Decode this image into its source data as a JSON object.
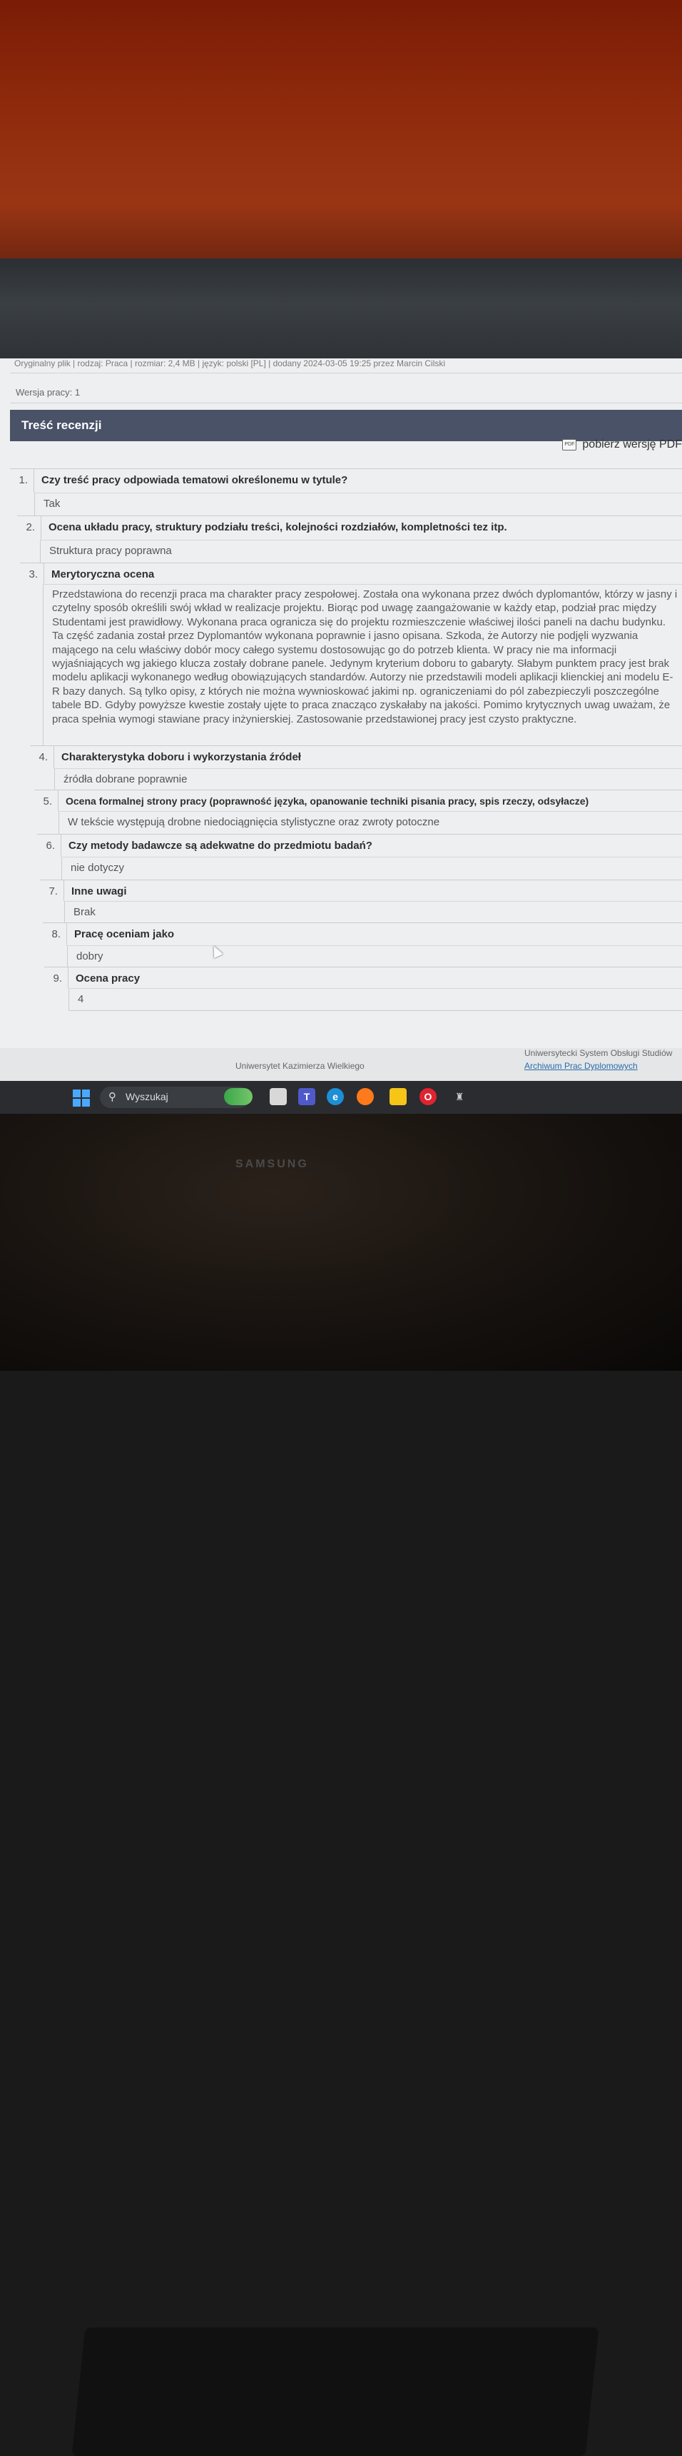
{
  "page": {
    "meta_line": "Oryginalny plik | rodzaj: Praca | rozmiar: 2,4 MB | język: polski [PL] | dodany 2024-03-05 19:25 przez Marcin Cilski",
    "version": "Wersja pracy: 1"
  },
  "review": {
    "header": "Treść recenzji",
    "pdf_label": "pobierz wersję PDF",
    "pdf_icon_text": "PDF",
    "items": [
      {
        "num": "1.",
        "question": "Czy treść pracy odpowiada tematowi określonemu w tytule?",
        "answer": "Tak"
      },
      {
        "num": "2.",
        "question": "Ocena układu pracy, struktury podziału treści, kolejności rozdziałów, kompletności tez itp.",
        "answer": "Struktura pracy poprawna"
      },
      {
        "num": "3.",
        "question": "Merytoryczna ocena",
        "answer": "Przedstawiona do recenzji praca ma charakter pracy zespołowej. Została ona wykonana przez dwóch dyplomantów, którzy w jasny i czytelny sposób określili swój wkład w realizacje projektu. Biorąc pod uwagę zaangażowanie w każdy etap, podział prac między Studentami jest prawidłowy. Wykonana praca ogranicza się do projektu rozmieszczenie właściwej ilości paneli na dachu budynku. Ta część zadania został przez Dyplomantów wykonana poprawnie i jasno opisana. Szkoda, że Autorzy nie podjęli wyzwania mającego na celu właściwy dobór mocy całego systemu dostosowując go do potrzeb klienta. W pracy nie ma informacji wyjaśniających wg jakiego klucza zostały dobrane panele. Jedynym kryterium doboru to gabaryty. Słabym punktem pracy jest brak modelu aplikacji wykonanego według obowiązujących standardów. Autorzy nie przedstawili modeli aplikacji klienckiej ani modelu E-R bazy danych. Są tylko opisy, z których nie można wywnioskować jakimi np. ograniczeniami do pól zabezpieczyli poszczególne tabele BD. Gdyby powyższe kwestie zostały ujęte to praca znacząco zyskałaby na jakości. Pomimo krytycznych uwag uważam, że praca spełnia wymogi stawiane pracy inżynierskiej. Zastosowanie przedstawionej pracy jest czysto praktyczne."
      },
      {
        "num": "4.",
        "question": "Charakterystyka doboru i wykorzystania źródeł",
        "answer": "źródła dobrane poprawnie"
      },
      {
        "num": "5.",
        "question": "Ocena formalnej strony pracy (poprawność języka, opanowanie techniki pisania pracy, spis rzeczy, odsyłacze)",
        "answer": "W tekście występują drobne niedociągnięcia stylistyczne oraz zwroty potoczne"
      },
      {
        "num": "6.",
        "question": "Czy metody badawcze są adekwatne do przedmiotu badań?",
        "answer": "nie dotyczy"
      },
      {
        "num": "7.",
        "question": "Inne uwagi",
        "answer": "Brak"
      },
      {
        "num": "8.",
        "question": "Pracę oceniam jako",
        "answer": "dobry"
      },
      {
        "num": "9.",
        "question": "Ocena pracy",
        "answer": "4"
      }
    ]
  },
  "footer": {
    "university": "Uniwersytet Kazimierza Wielkiego",
    "system": "Uniwersytecki System Obsługi Studiów",
    "archive_link": "Archiwum Prac Dyplomowych"
  },
  "taskbar": {
    "search_placeholder": "Wyszukaj",
    "icons": [
      "windows-start-icon",
      "search-icon",
      "widgets-icon",
      "task-view-icon",
      "teams-icon",
      "edge-icon",
      "firefox-icon",
      "file-explorer-icon",
      "opera-icon",
      "game-icon"
    ]
  },
  "monitor_brand": "SAMSUNG"
}
